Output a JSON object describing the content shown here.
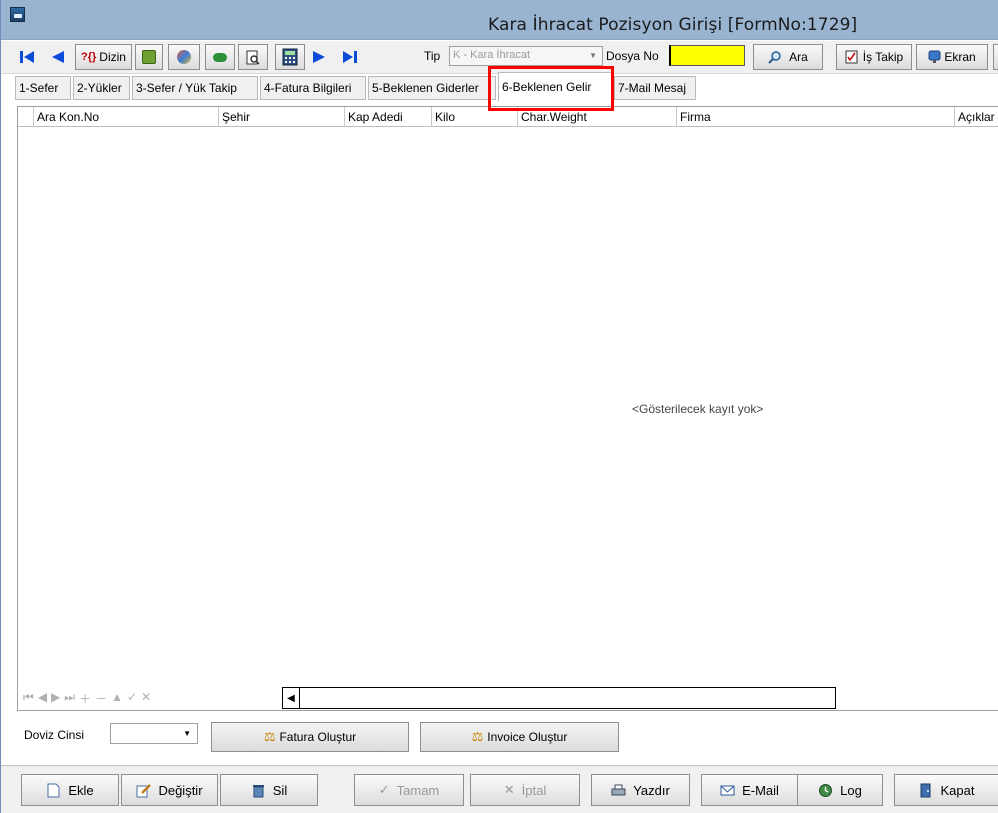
{
  "window": {
    "title": "Kara İhracat Pozisyon Girişi [FormNo:1729]"
  },
  "toolbar": {
    "dizin_label": "Dizin",
    "dizin_prefix": "?{}",
    "tip_label": "Tip",
    "tip_value": "K - Kara İhracat",
    "dosya_label": "Dosya No",
    "ara_label": "Ara",
    "is_takip_label": "İş Takip",
    "ekran_label": "Ekran"
  },
  "tabs": [
    {
      "label": "1-Sefer"
    },
    {
      "label": "2-Yükler"
    },
    {
      "label": "3-Sefer / Yük Takip"
    },
    {
      "label": "4-Fatura Bilgileri"
    },
    {
      "label": "5-Beklenen Giderler"
    },
    {
      "label": "6-Beklenen Gelir",
      "active": true
    },
    {
      "label": "7-Mail Mesaj"
    }
  ],
  "grid": {
    "columns": [
      "Ara Kon.No",
      "Şehir",
      "Kap Adedi",
      "Kilo",
      "Char.Weight",
      "Firma",
      "Açıklar"
    ],
    "empty_message": "<Gösterilecek kayıt yok>"
  },
  "footer": {
    "doviz_label": "Doviz Cinsi",
    "doviz_value": "",
    "fatura_button": "Fatura Oluştur",
    "invoice_button": "Invoice Oluştur"
  },
  "actions": {
    "ekle": "Ekle",
    "degistir": "Değiştir",
    "sil": "Sil",
    "tamam": "Tamam",
    "iptal": "İptal",
    "yazdir": "Yazdır",
    "email": "E-Mail",
    "log": "Log",
    "kapat": "Kapat"
  },
  "colors": {
    "title_bar": "#99b4d1",
    "highlight": "#ff0000",
    "dosya_input": "#ffff00",
    "nav_blue": "#0a4bd8"
  }
}
